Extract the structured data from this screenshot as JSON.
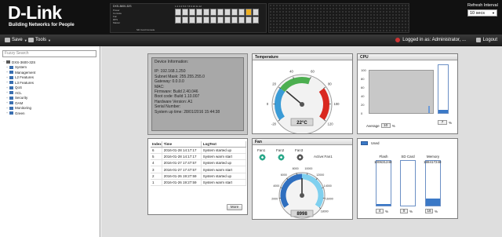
{
  "header": {
    "logo": "D-Link",
    "tagline": "Building Networks for People",
    "model": "DXS-3600-32S",
    "leds": [
      "Power",
      "Console",
      "Fan",
      "RPS",
      "Master"
    ],
    "port_labels": [
      "1 2 3 4 5 6 7 8 9 10 11 12",
      "13 14 15 16 17 18 19 20 21 22 23 24"
    ],
    "console_label": "SD Card Console",
    "refresh_label": "Refresh Interval",
    "refresh_value": "10 secs"
  },
  "menubar": {
    "save": "Save",
    "tools": "Tools",
    "logged_in": "Logged in as: Administrator, ...",
    "logout": "Logout"
  },
  "sidebar": {
    "search_placeholder": "Fuzzy Search",
    "root": "DXS-3600-32S",
    "items": [
      "System",
      "Management",
      "L2 Features",
      "L3 Features",
      "QoS",
      "ACL",
      "Security",
      "OAM",
      "Monitoring",
      "Green"
    ]
  },
  "device_info": {
    "title": "Device Information:",
    "lines": [
      "IP: 192.168.1.250",
      "Subnet Mask: 255.255.255.0",
      "Gateway: 0.0.0.0",
      "MAC:",
      "Firmware: Build 2.40.046",
      "Boot code: Build 1.10.007",
      "Hardware Version: A1",
      "Serial Number:",
      "System up time:  28/01/2016 15:44:38"
    ]
  },
  "temperature": {
    "title": "Temperature",
    "value": 22,
    "unit": "°C",
    "display": "22°C",
    "scale_min": -20,
    "scale_max": 120,
    "ticks": [
      "-20",
      "0",
      "20",
      "40",
      "60",
      "80",
      "100",
      "120"
    ],
    "colors": {
      "cold": "#3a9bd6",
      "normal": "#4caf50",
      "hot": "#d9281f"
    }
  },
  "cpu": {
    "title": "CPU",
    "y_ticks": [
      "100",
      "80",
      "60",
      "40",
      "20",
      "0"
    ],
    "average_label": "Average",
    "average_value": "10",
    "current_value": "7",
    "percent": "%",
    "current_fraction": 0.07
  },
  "log": {
    "headers": [
      "Index",
      "Time",
      "LogText"
    ],
    "rows": [
      [
        "6",
        "2016-01-28 14:17:17",
        "System started up"
      ],
      [
        "5",
        "2016-01-28 14:17:17",
        "System warm start"
      ],
      [
        "4",
        "2016-01-27 17:47:57",
        "System started up"
      ],
      [
        "3",
        "2016-01-27 17:47:57",
        "System warm start"
      ],
      [
        "2",
        "2016-01-26 19:27:59",
        "System started up"
      ],
      [
        "1",
        "2016-01-26 19:27:59",
        "System warm start"
      ]
    ],
    "more": "More"
  },
  "fan": {
    "title": "Fan",
    "fans": [
      "Fan1",
      "Fan2",
      "Fan3"
    ],
    "active": "Active:Fan1",
    "value": "8998",
    "rpm": 8998,
    "scale_max": 18000,
    "ticks": [
      "2000",
      "4000",
      "6000",
      "8000",
      "10000",
      "12000",
      "14000",
      "16000",
      "18000"
    ]
  },
  "storage": {
    "legend": "Used",
    "items": [
      {
        "name": "Flash",
        "value": "100631248",
        "pct": "4",
        "fraction": 0.04
      },
      {
        "name": "SD Card",
        "value": "",
        "pct": "0",
        "fraction": 0.0
      },
      {
        "name": "Memory",
        "value": "188417248",
        "pct": "16",
        "fraction": 0.16
      }
    ],
    "percent": "%"
  }
}
